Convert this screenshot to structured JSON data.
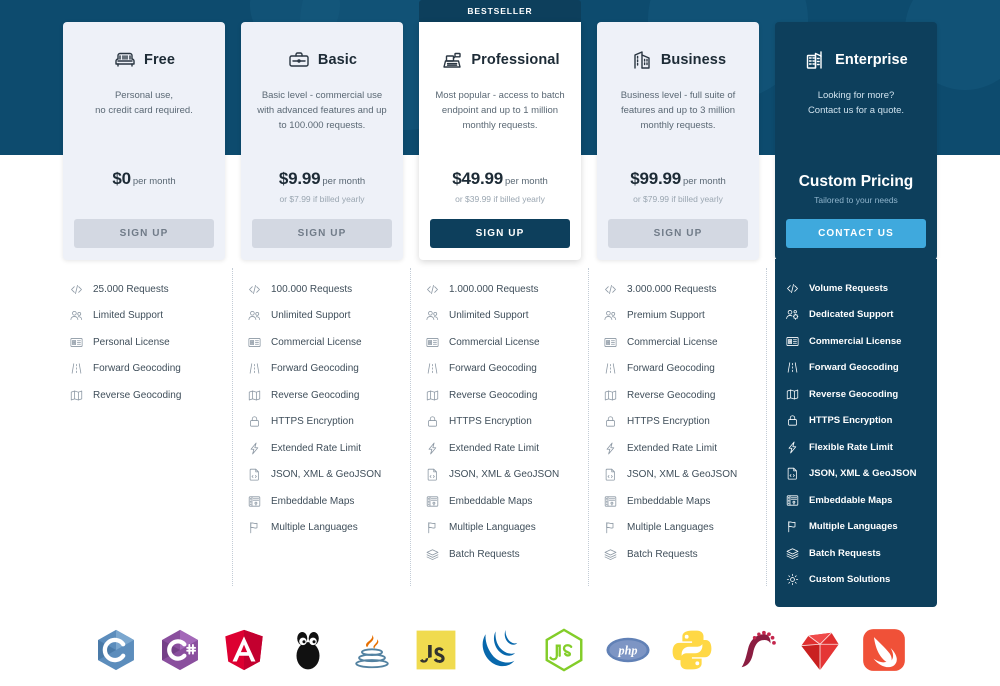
{
  "theme": {
    "header_bg": "#0d4b6e",
    "dark_card_bg": "#0d3f5c",
    "light_card_bg": "#eef1f8",
    "accent_button": "#3fa9dd",
    "muted_button": "#d3d8e2",
    "page_bg": "#ffffff"
  },
  "badge": {
    "bestseller": "BESTSELLER"
  },
  "plans": [
    {
      "id": "free",
      "icon": "armchair-icon",
      "name": "Free",
      "description": "Personal use,\nno credit card required.",
      "price_amount": "$0",
      "price_period": "per month",
      "price_yearly": "",
      "cta_label": "SIGN UP",
      "featured": false,
      "dark": false,
      "features": [
        {
          "icon": "code-icon",
          "label": "25.000 Requests"
        },
        {
          "icon": "users-icon",
          "label": "Limited Support"
        },
        {
          "icon": "license-icon",
          "label": "Personal License"
        },
        {
          "icon": "road-icon",
          "label": "Forward Geocoding"
        },
        {
          "icon": "map-icon",
          "label": "Reverse Geocoding"
        }
      ]
    },
    {
      "id": "basic",
      "icon": "briefcase-icon",
      "name": "Basic",
      "description": "Basic level - commercial use with advanced features and up to 100.000 requests.",
      "price_amount": "$9.99",
      "price_period": "per month",
      "price_yearly": "or $7.99 if billed yearly",
      "cta_label": "SIGN UP",
      "featured": false,
      "dark": false,
      "features": [
        {
          "icon": "code-icon",
          "label": "100.000 Requests"
        },
        {
          "icon": "users-icon",
          "label": "Unlimited Support"
        },
        {
          "icon": "license-icon",
          "label": "Commercial License"
        },
        {
          "icon": "road-icon",
          "label": "Forward Geocoding"
        },
        {
          "icon": "map-icon",
          "label": "Reverse Geocoding"
        },
        {
          "icon": "lock-icon",
          "label": "HTTPS Encryption"
        },
        {
          "icon": "bolt-icon",
          "label": "Extended Rate Limit"
        },
        {
          "icon": "file-code-icon",
          "label": "JSON, XML & GeoJSON"
        },
        {
          "icon": "embed-map-icon",
          "label": "Embeddable Maps"
        },
        {
          "icon": "flag-icon",
          "label": "Multiple Languages"
        }
      ]
    },
    {
      "id": "professional",
      "icon": "cash-register-icon",
      "name": "Professional",
      "description": "Most popular - access to batch endpoint and up to 1 million monthly requests.",
      "price_amount": "$49.99",
      "price_period": "per month",
      "price_yearly": "or $39.99 if billed yearly",
      "cta_label": "SIGN UP",
      "featured": true,
      "dark": false,
      "features": [
        {
          "icon": "code-icon",
          "label": "1.000.000 Requests"
        },
        {
          "icon": "users-icon",
          "label": "Unlimited Support"
        },
        {
          "icon": "license-icon",
          "label": "Commercial License"
        },
        {
          "icon": "road-icon",
          "label": "Forward Geocoding"
        },
        {
          "icon": "map-icon",
          "label": "Reverse Geocoding"
        },
        {
          "icon": "lock-icon",
          "label": "HTTPS Encryption"
        },
        {
          "icon": "bolt-icon",
          "label": "Extended Rate Limit"
        },
        {
          "icon": "file-code-icon",
          "label": "JSON, XML & GeoJSON"
        },
        {
          "icon": "embed-map-icon",
          "label": "Embeddable Maps"
        },
        {
          "icon": "flag-icon",
          "label": "Multiple Languages"
        },
        {
          "icon": "layers-icon",
          "label": "Batch Requests"
        }
      ]
    },
    {
      "id": "business",
      "icon": "buildings-icon",
      "name": "Business",
      "description": "Business level - full suite of features and up to 3 million monthly requests.",
      "price_amount": "$99.99",
      "price_period": "per month",
      "price_yearly": "or $79.99 if billed yearly",
      "cta_label": "SIGN UP",
      "featured": false,
      "dark": false,
      "features": [
        {
          "icon": "code-icon",
          "label": "3.000.000 Requests"
        },
        {
          "icon": "users-icon",
          "label": "Premium Support"
        },
        {
          "icon": "license-icon",
          "label": "Commercial License"
        },
        {
          "icon": "road-icon",
          "label": "Forward Geocoding"
        },
        {
          "icon": "map-icon",
          "label": "Reverse Geocoding"
        },
        {
          "icon": "lock-icon",
          "label": "HTTPS Encryption"
        },
        {
          "icon": "bolt-icon",
          "label": "Extended Rate Limit"
        },
        {
          "icon": "file-code-icon",
          "label": "JSON, XML & GeoJSON"
        },
        {
          "icon": "embed-map-icon",
          "label": "Embeddable Maps"
        },
        {
          "icon": "flag-icon",
          "label": "Multiple Languages"
        },
        {
          "icon": "layers-icon",
          "label": "Batch Requests"
        }
      ]
    },
    {
      "id": "enterprise",
      "icon": "skyscraper-icon",
      "name": "Enterprise",
      "description": "Looking for more?\nContact us for a quote.",
      "custom_price_title": "Custom Pricing",
      "custom_price_sub": "Tailored to your needs",
      "cta_label": "CONTACT US",
      "featured": false,
      "dark": true,
      "features": [
        {
          "icon": "code-icon",
          "label": "Volume Requests"
        },
        {
          "icon": "users-gear-icon",
          "label": "Dedicated Support"
        },
        {
          "icon": "license-icon",
          "label": "Commercial License"
        },
        {
          "icon": "road-icon",
          "label": "Forward Geocoding"
        },
        {
          "icon": "map-icon",
          "label": "Reverse Geocoding"
        },
        {
          "icon": "lock-icon",
          "label": "HTTPS Encryption"
        },
        {
          "icon": "bolt-icon",
          "label": "Flexible Rate Limit"
        },
        {
          "icon": "file-code-icon",
          "label": "JSON, XML & GeoJSON"
        },
        {
          "icon": "embed-map-icon",
          "label": "Embeddable Maps"
        },
        {
          "icon": "flag-icon",
          "label": "Multiple Languages"
        },
        {
          "icon": "layers-icon",
          "label": "Batch Requests"
        },
        {
          "icon": "gear-icon",
          "label": "Custom Solutions"
        }
      ]
    }
  ],
  "technologies": [
    {
      "id": "c",
      "name": "C",
      "color": "#5c8dbc"
    },
    {
      "id": "csharp",
      "name": "C#",
      "color": "#8a4f9e"
    },
    {
      "id": "angular",
      "name": "Angular",
      "color": "#dd0031"
    },
    {
      "id": "go",
      "name": "Go",
      "color": "#111111"
    },
    {
      "id": "java",
      "name": "Java",
      "color": "#e76f00"
    },
    {
      "id": "js",
      "name": "JavaScript",
      "color": "#f0db4f"
    },
    {
      "id": "jquery",
      "name": "jQuery",
      "color": "#0868ac"
    },
    {
      "id": "nodejs",
      "name": "Node.js",
      "color": "#83cd29"
    },
    {
      "id": "php",
      "name": "PHP",
      "color": "#4f5b93"
    },
    {
      "id": "python",
      "name": "Python",
      "color": "#ffd845"
    },
    {
      "id": "perl",
      "name": "Perl",
      "color": "#8b1d41"
    },
    {
      "id": "ruby",
      "name": "Ruby",
      "color": "#e02f2f"
    },
    {
      "id": "swift",
      "name": "Swift",
      "color": "#f05138"
    }
  ]
}
